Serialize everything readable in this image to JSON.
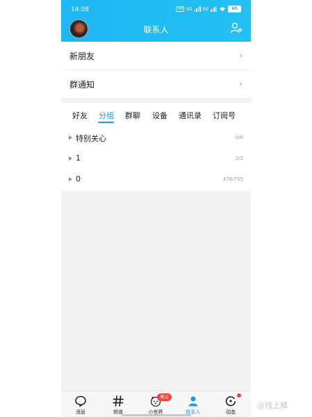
{
  "status_bar": {
    "time": "14:08",
    "battery": "65",
    "signal1": "5G",
    "signal2": "5G"
  },
  "header": {
    "title": "联系人"
  },
  "rows": {
    "new_friends": "新朋友",
    "group_notice": "群通知",
    "chevron": "›"
  },
  "tabs": [
    {
      "label": "好友",
      "active": false
    },
    {
      "label": "分组",
      "active": true
    },
    {
      "label": "群聊",
      "active": false
    },
    {
      "label": "设备",
      "active": false
    },
    {
      "label": "通讯录",
      "active": false
    },
    {
      "label": "订阅号",
      "active": false
    }
  ],
  "groups": [
    {
      "name": "特别关心",
      "count": "0/0"
    },
    {
      "name": "1",
      "count": "2/2"
    },
    {
      "name": "0",
      "count": "476/755"
    }
  ],
  "bottom_nav": [
    {
      "label": "消息",
      "icon": "message-icon",
      "active": false
    },
    {
      "label": "频道",
      "icon": "hashtag-icon",
      "active": false
    },
    {
      "label": "小世界",
      "icon": "small-world-icon",
      "active": false
    },
    {
      "label": "联系人",
      "icon": "contacts-icon",
      "active": true
    },
    {
      "label": "动态",
      "icon": "activity-icon",
      "active": false
    }
  ],
  "badges": {
    "small_world": "来过"
  },
  "watermark": "@钱上橘",
  "colors": {
    "header": "#1fb6f4",
    "accent": "#1a9de6",
    "badge": "#f0413b"
  }
}
